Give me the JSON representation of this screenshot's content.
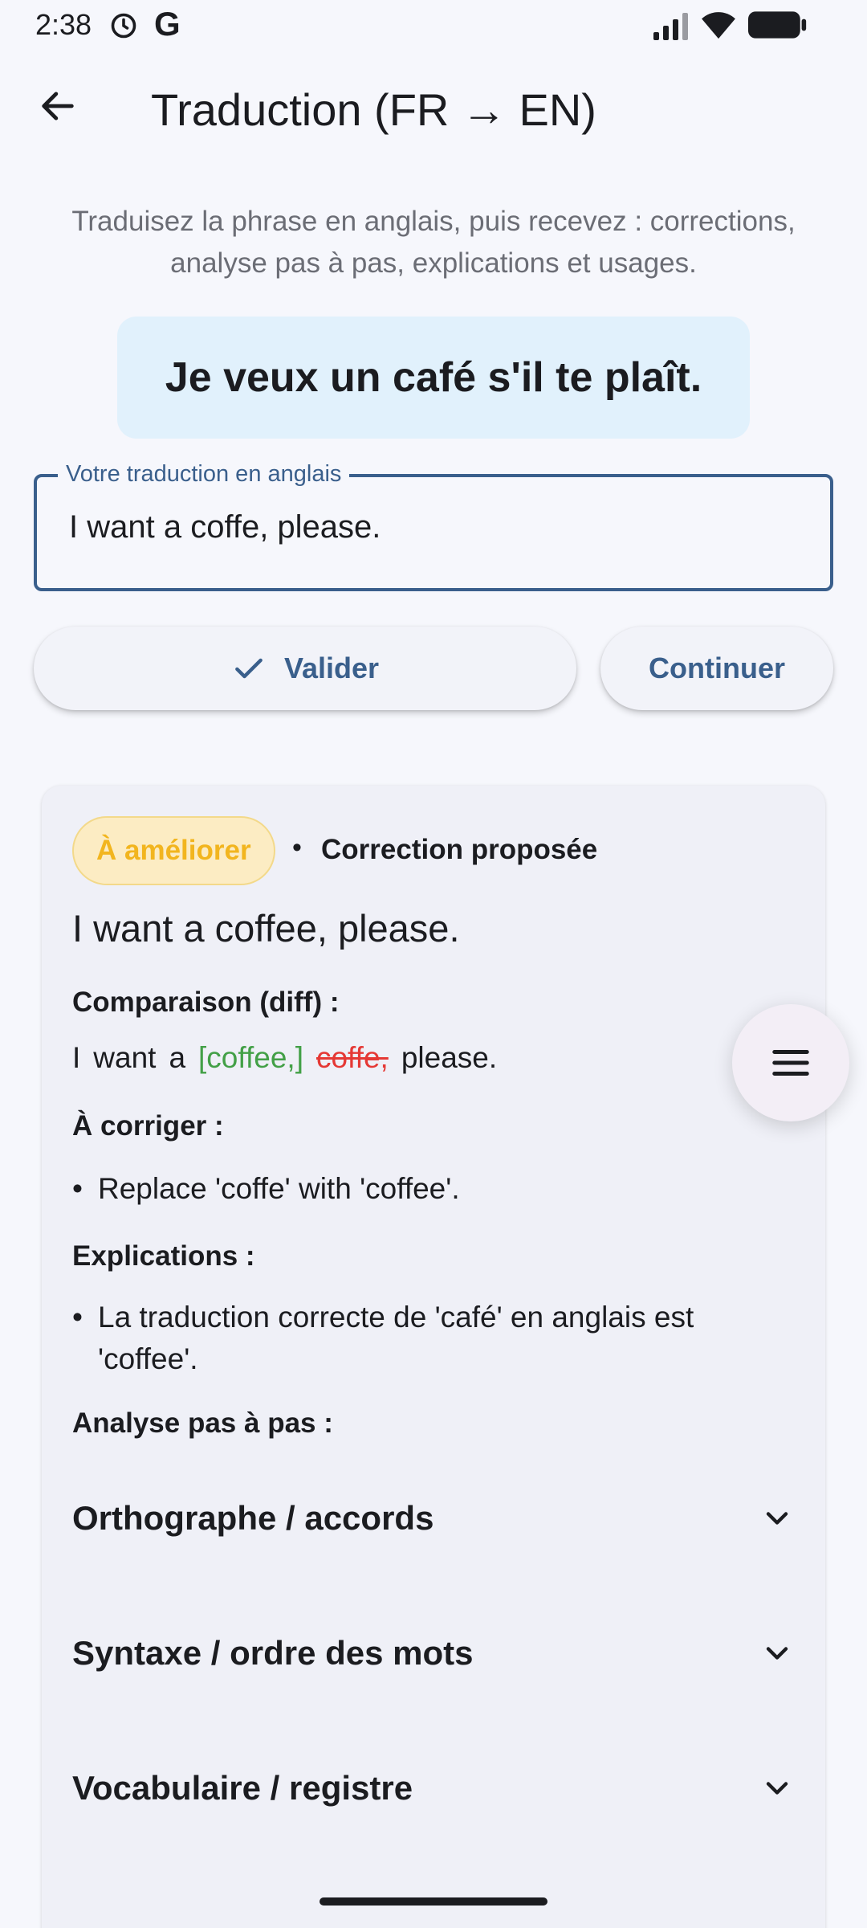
{
  "status_bar": {
    "time": "2:38",
    "g_glyph": "G",
    "icons": [
      "alarm-icon",
      "google-icon",
      "signal-icon",
      "wifi-icon",
      "battery-icon"
    ]
  },
  "app_bar": {
    "title": "Traduction (FR → EN)",
    "back_icon": "arrow-back-icon"
  },
  "instructions": "Traduisez la phrase en anglais, puis recevez : corrections, analyse pas à pas, explications et usages.",
  "source_sentence": "Je veux un café s'il te plaît.",
  "translation_field": {
    "label": "Votre traduction en anglais",
    "value": "I want a coffe, please."
  },
  "buttons": {
    "validate": "Valider",
    "continue": "Continuer"
  },
  "result": {
    "badge": "À améliorer",
    "separator": "•",
    "correction_label": "Correction proposée",
    "corrected_text": "I want a coffee, please.",
    "diff_heading": "Comparaison (diff) :",
    "diff_tokens": [
      {
        "text": "I",
        "type": "plain"
      },
      {
        "text": "want",
        "type": "plain"
      },
      {
        "text": "a",
        "type": "plain"
      },
      {
        "text": "[coffee,]",
        "type": "added"
      },
      {
        "text": "coffe,",
        "type": "removed"
      },
      {
        "text": "please.",
        "type": "plain"
      }
    ],
    "to_fix_heading": "À corriger :",
    "to_fix": [
      "Replace 'coffe' with 'coffee'."
    ],
    "explanations_heading": "Explications :",
    "explanations": [
      "La traduction correcte de 'café' en anglais est 'coffee'."
    ],
    "analysis_heading": "Analyse pas à pas :",
    "analysis_sections": [
      "Orthographe / accords",
      "Syntaxe / ordre des mots",
      "Vocabulaire / registre"
    ],
    "bullet_glyph": "•"
  },
  "fab_icon": "menu-icon",
  "colors": {
    "background": "#f6f7fc",
    "primary": "#3a5f8c",
    "source_card": "#e1f1fc",
    "badge_bg": "#fcecc3",
    "badge_text": "#f2b51e",
    "diff_added": "#43a047",
    "diff_removed": "#e53935"
  }
}
